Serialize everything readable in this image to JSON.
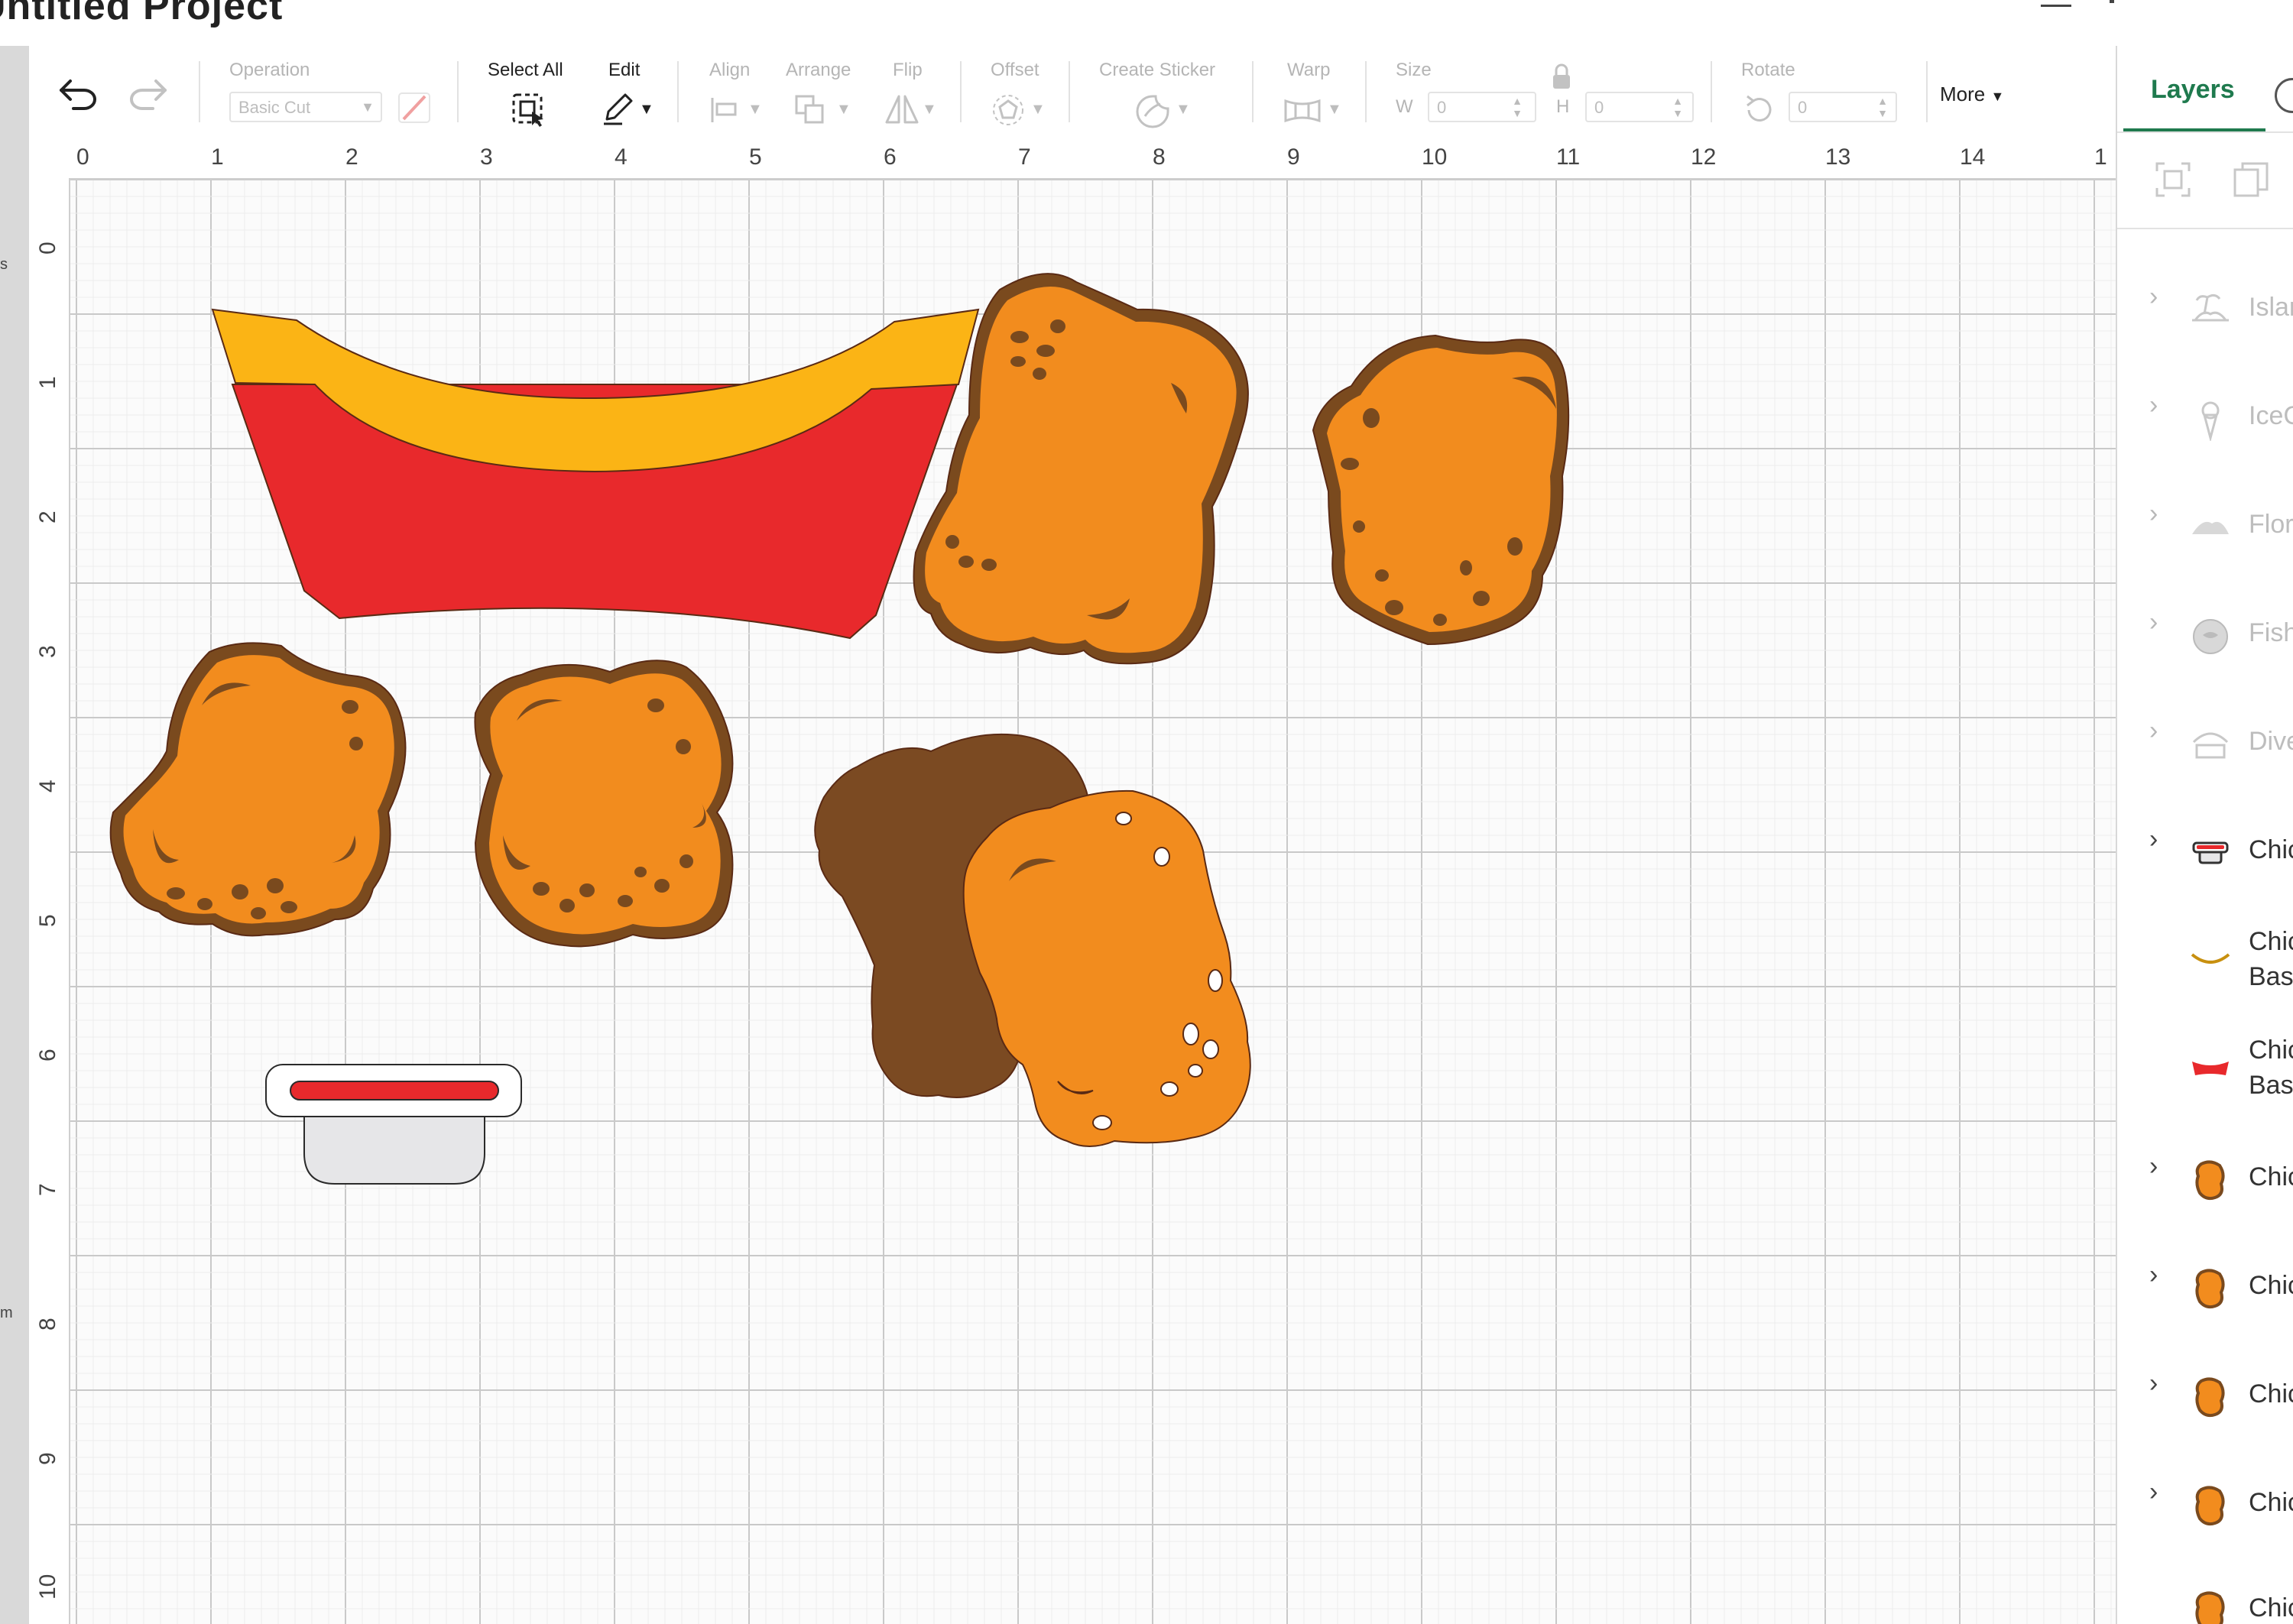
{
  "app": {
    "project_title": "Untitled Project"
  },
  "toolbar": {
    "undo_icon": "undo-icon",
    "redo_icon": "redo-icon",
    "operation_label": "Operation",
    "operation_value": "Basic Cut",
    "select_all_label": "Select All",
    "edit_label": "Edit",
    "align_label": "Align",
    "arrange_label": "Arrange",
    "flip_label": "Flip",
    "offset_label": "Offset",
    "create_sticker_label": "Create Sticker",
    "warp_label": "Warp",
    "size_label": "Size",
    "width_prefix": "W",
    "width_value": "0",
    "height_prefix": "H",
    "height_value": "0",
    "rotate_label": "Rotate",
    "rotate_value": "0",
    "more_label": "More"
  },
  "rulers": {
    "horizontal": [
      "0",
      "1",
      "2",
      "3",
      "4",
      "5",
      "6",
      "7",
      "8",
      "9",
      "10",
      "11",
      "12",
      "13",
      "14",
      "1"
    ],
    "vertical": [
      "0",
      "1",
      "2",
      "3",
      "4",
      "5",
      "6",
      "7",
      "8",
      "9",
      "10"
    ],
    "strip_letters": [
      "s",
      "m"
    ]
  },
  "layers_panel": {
    "tab_label": "Layers",
    "items": [
      {
        "label": "Islar",
        "label2": "",
        "chevron": true,
        "dim": true,
        "icon": "island-icon"
      },
      {
        "label": "IceC",
        "label2": "",
        "chevron": true,
        "dim": true,
        "icon": "ice-cream-icon"
      },
      {
        "label": "Flor",
        "label2": "",
        "chevron": true,
        "dim": true,
        "icon": "florida-icon"
      },
      {
        "label": "Fish",
        "label2": "",
        "chevron": true,
        "dim": true,
        "icon": "fishbowl-icon"
      },
      {
        "label": "Dive",
        "label2": "",
        "chevron": true,
        "dim": true,
        "icon": "portfolio-icon"
      },
      {
        "label": "Chic",
        "label2": "",
        "chevron": true,
        "dim": false,
        "icon": "sauce-cup-icon"
      },
      {
        "label": "Chic",
        "label2": "Basi",
        "chevron": false,
        "dim": false,
        "icon": "basket-rim-icon"
      },
      {
        "label": "Chic",
        "label2": "Basi",
        "chevron": false,
        "dim": false,
        "icon": "basket-body-icon"
      },
      {
        "label": "Chic",
        "label2": "",
        "chevron": true,
        "dim": false,
        "icon": "nugget-icon"
      },
      {
        "label": "Chic",
        "label2": "",
        "chevron": true,
        "dim": false,
        "icon": "nugget-icon"
      },
      {
        "label": "Chic",
        "label2": "",
        "chevron": true,
        "dim": false,
        "icon": "nugget-icon"
      },
      {
        "label": "Chic",
        "label2": "",
        "chevron": true,
        "dim": false,
        "icon": "nugget-icon"
      },
      {
        "label": "Chic",
        "label2": "",
        "chevron": false,
        "dim": false,
        "icon": "nugget-icon"
      }
    ]
  },
  "colors": {
    "nugget_fill": "#f28c1e",
    "nugget_border": "#7a4a1e",
    "nugget_dark": "#7b4a22",
    "basket_red": "#e8292c",
    "basket_yellow": "#fbb415",
    "sauce_red": "#e8292c",
    "sauce_cup": "#e6e6e8",
    "accent_green": "#1f7a4e"
  }
}
